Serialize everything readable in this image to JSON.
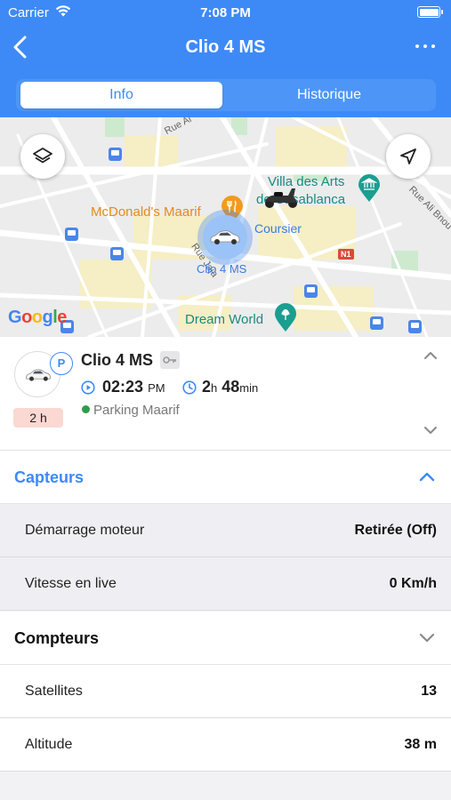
{
  "status_bar": {
    "carrier": "Carrier",
    "time": "7:08 PM"
  },
  "nav": {
    "title": "Clio 4 MS"
  },
  "tabs": [
    {
      "label": "Info",
      "selected": true
    },
    {
      "label": "Historique",
      "selected": false
    }
  ],
  "map": {
    "pois": {
      "mcdonalds": "McDonald's Maarif",
      "villa_line1": "Villa des Arts",
      "villa_line2": "de Casablanca",
      "coursier": "Coursier",
      "dream_world": "Dream World"
    },
    "car_marker_label": "Clio 4 MS",
    "streets": {
      "rue_top": "Rue Al",
      "rue_bottom": "Rue Jaja",
      "rue_right": "Rue Ali Bnou"
    },
    "road_badge": "N1",
    "attribution": {
      "g1": "G",
      "o1": "o",
      "o2": "o",
      "g2": "g",
      "l": "l",
      "e": "e"
    }
  },
  "vehicle": {
    "name": "Clio 4 MS",
    "parking_badge": "P",
    "duration_badge": "2 h",
    "time_value": "02:23",
    "time_suffix": "PM",
    "duration_hours": "2",
    "duration_hours_unit": "h",
    "duration_minutes": "48",
    "duration_minutes_unit": "min",
    "location": "Parking Maarif"
  },
  "capteurs": {
    "title": "Capteurs",
    "expanded": true,
    "rows": [
      {
        "label": "Démarrage moteur",
        "value": "Retirée (Off)"
      },
      {
        "label": "Vitesse en live",
        "value": "0 Km/h"
      }
    ]
  },
  "compteurs": {
    "title": "Compteurs",
    "expanded": false,
    "rows": [
      {
        "label": "Satellites",
        "value": "13"
      },
      {
        "label": "Altitude",
        "value": "38 m"
      }
    ]
  },
  "colors": {
    "primary": "#3d8af7",
    "badge_bg": "#fbd8d2",
    "status_online": "#2f9d47",
    "poi_food": "#e48b1a",
    "poi_park": "#168b80"
  }
}
